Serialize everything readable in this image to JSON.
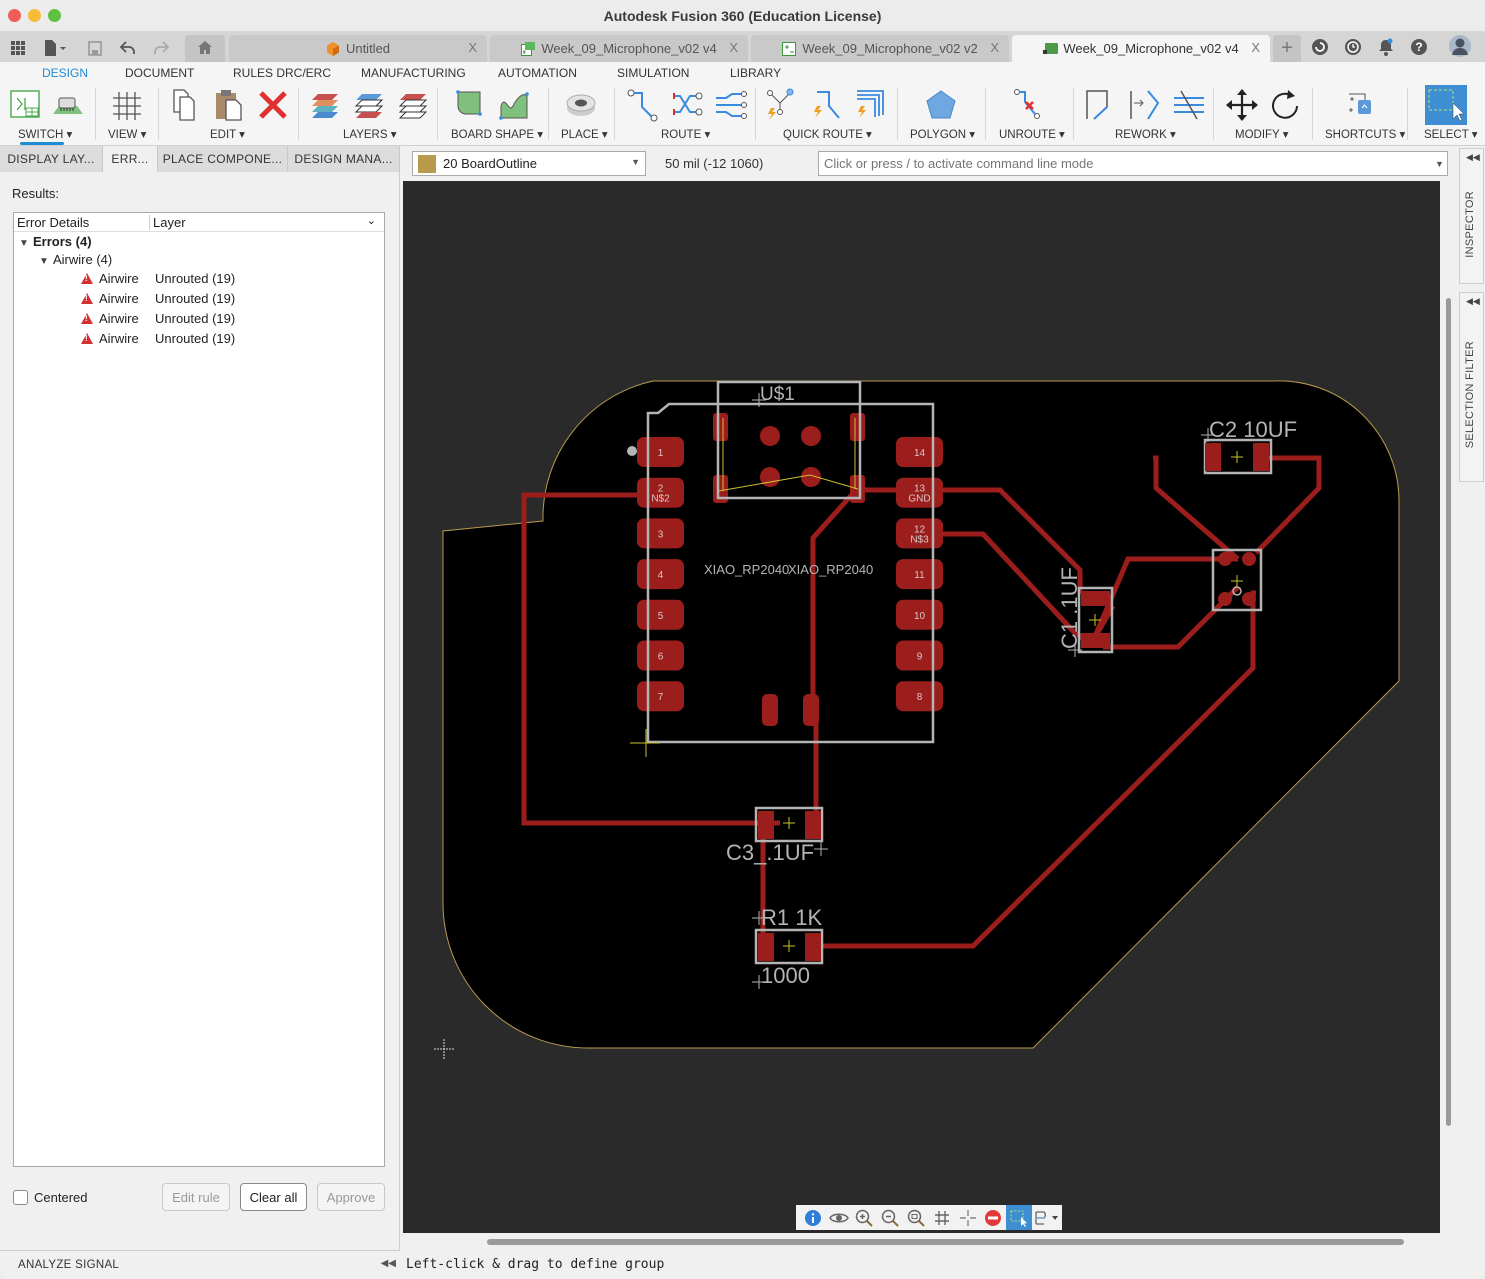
{
  "window": {
    "title": "Autodesk Fusion 360 (Education License)"
  },
  "tabs": [
    {
      "label": "Untitled",
      "icon": "cube-icon",
      "active": false
    },
    {
      "label": "Week_09_Microphone_v02 v4",
      "icon": "schematic-icon",
      "active": false
    },
    {
      "label": "Week_09_Microphone_v02 v2",
      "icon": "schematic-icon",
      "active": false
    },
    {
      "label": "Week_09_Microphone_v02 v4",
      "icon": "pcb-icon",
      "active": true
    }
  ],
  "ribbon": {
    "tabs": [
      "DESIGN",
      "DOCUMENT",
      "RULES DRC/ERC",
      "MANUFACTURING",
      "AUTOMATION",
      "SIMULATION",
      "LIBRARY"
    ],
    "active_tab": "DESIGN",
    "groups": [
      "SWITCH ▾",
      "VIEW ▾",
      "EDIT ▾",
      "LAYERS ▾",
      "BOARD SHAPE ▾",
      "PLACE ▾",
      "ROUTE ▾",
      "QUICK ROUTE ▾",
      "POLYGON ▾",
      "UNROUTE ▾",
      "REWORK ▾",
      "MODIFY ▾",
      "SHORTCUTS ▾",
      "SELECT ▾"
    ]
  },
  "left_panel": {
    "tabs": [
      "DISPLAY LAY...",
      "ERR...",
      "PLACE COMPONE...",
      "DESIGN MANA..."
    ],
    "active_tab": "ERR...",
    "results_label": "Results:",
    "columns": [
      "Error Details",
      "Layer"
    ],
    "tree": {
      "root": "Errors (4)",
      "group": "Airwire (4)",
      "items": [
        {
          "name": "Airwire",
          "layer": "Unrouted (19)"
        },
        {
          "name": "Airwire",
          "layer": "Unrouted (19)"
        },
        {
          "name": "Airwire",
          "layer": "Unrouted (19)"
        },
        {
          "name": "Airwire",
          "layer": "Unrouted (19)"
        }
      ]
    },
    "centered_label": "Centered",
    "centered_checked": false,
    "buttons": {
      "edit_rule": "Edit rule",
      "clear_all": "Clear all",
      "approve": "Approve"
    },
    "analyze_signal": "ANALYZE SIGNAL"
  },
  "command_row": {
    "layer": "20 BoardOutline",
    "layer_color": "#b89a4d",
    "grid_readout": "50 mil (-12 1060)",
    "command_placeholder": "Click or press / to activate command line mode"
  },
  "side_panels": [
    "INSPECTOR",
    "SELECTION FILTER"
  ],
  "board": {
    "labels": {
      "u1": "U$1",
      "xiao_left": "XIAO_RP2040",
      "xiao_right": "XIAO_RP2040",
      "c2": "C2  10UF",
      "c1": "C1  .1UF",
      "c3": "C3_.1UF",
      "r1": "R1  1K",
      "r1_value": "1000"
    },
    "left_pins": [
      "1",
      "2",
      "3",
      "4",
      "5",
      "6",
      "7"
    ],
    "right_pins": [
      "14",
      "13",
      "12",
      "11",
      "10",
      "9",
      "8"
    ],
    "pin_nets": {
      "2": "N$2",
      "13": "GND",
      "12": "N$3"
    },
    "colors": {
      "copper": "#9b1e1c",
      "outline": "#b89a4d",
      "silk": "#b4b4b4",
      "board": "#000000"
    }
  },
  "navbar": [
    "info-icon",
    "eye-icon",
    "zoom-in-icon",
    "zoom-out-icon",
    "zoom-fit-icon",
    "grid-icon",
    "crosshair-icon",
    "stop-icon",
    "select-box-icon",
    "route-icon"
  ],
  "status": "Left-click & drag to define group"
}
